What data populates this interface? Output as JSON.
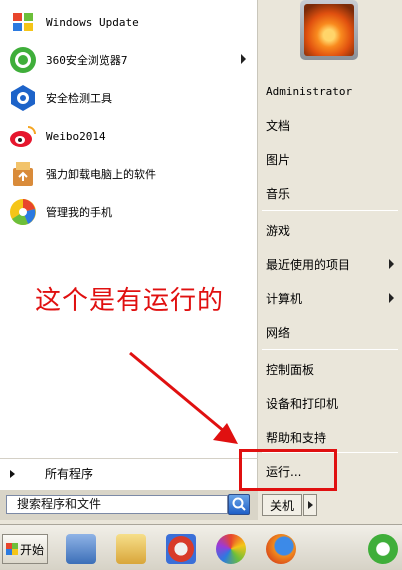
{
  "left_panel": {
    "programs": [
      {
        "label": "Windows Update",
        "icon": "windows-update-icon",
        "has_submenu": false
      },
      {
        "label": "360安全浏览器7",
        "icon": "360-browser-icon",
        "has_submenu": true
      },
      {
        "label": "安全检测工具",
        "icon": "security-tool-icon",
        "has_submenu": false
      },
      {
        "label": "Weibo2014",
        "icon": "weibo-icon",
        "has_submenu": false
      },
      {
        "label": "强力卸载电脑上的软件",
        "icon": "uninstaller-icon",
        "has_submenu": false
      },
      {
        "label": "管理我的手机",
        "icon": "phone-manager-icon",
        "has_submenu": false
      }
    ],
    "all_programs_label": "所有程序",
    "search_placeholder": "搜索程序和文件"
  },
  "right_panel": {
    "user_name": "Administrator",
    "items": [
      {
        "label": "文档",
        "has_submenu": false
      },
      {
        "label": "图片",
        "has_submenu": false
      },
      {
        "label": "音乐",
        "has_submenu": false
      },
      {
        "label": "游戏",
        "has_submenu": false
      },
      {
        "label": "最近使用的项目",
        "has_submenu": true
      },
      {
        "label": "计算机",
        "has_submenu": true
      },
      {
        "label": "网络",
        "has_submenu": false
      },
      {
        "label": "控制面板",
        "has_submenu": false
      },
      {
        "label": "设备和打印机",
        "has_submenu": false
      },
      {
        "label": "帮助和支持",
        "has_submenu": false
      },
      {
        "label": "运行...",
        "has_submenu": false
      }
    ],
    "shutdown_label": "关机"
  },
  "annotation": {
    "text": "这个是有运行的",
    "color": "#e01010"
  },
  "taskbar": {
    "start_label": "开始",
    "pinned_icons": [
      "calculator-icon",
      "explorer-icon",
      "ccleaner-icon",
      "media-player-icon",
      "firefox-icon",
      "360-browser-icon"
    ]
  }
}
